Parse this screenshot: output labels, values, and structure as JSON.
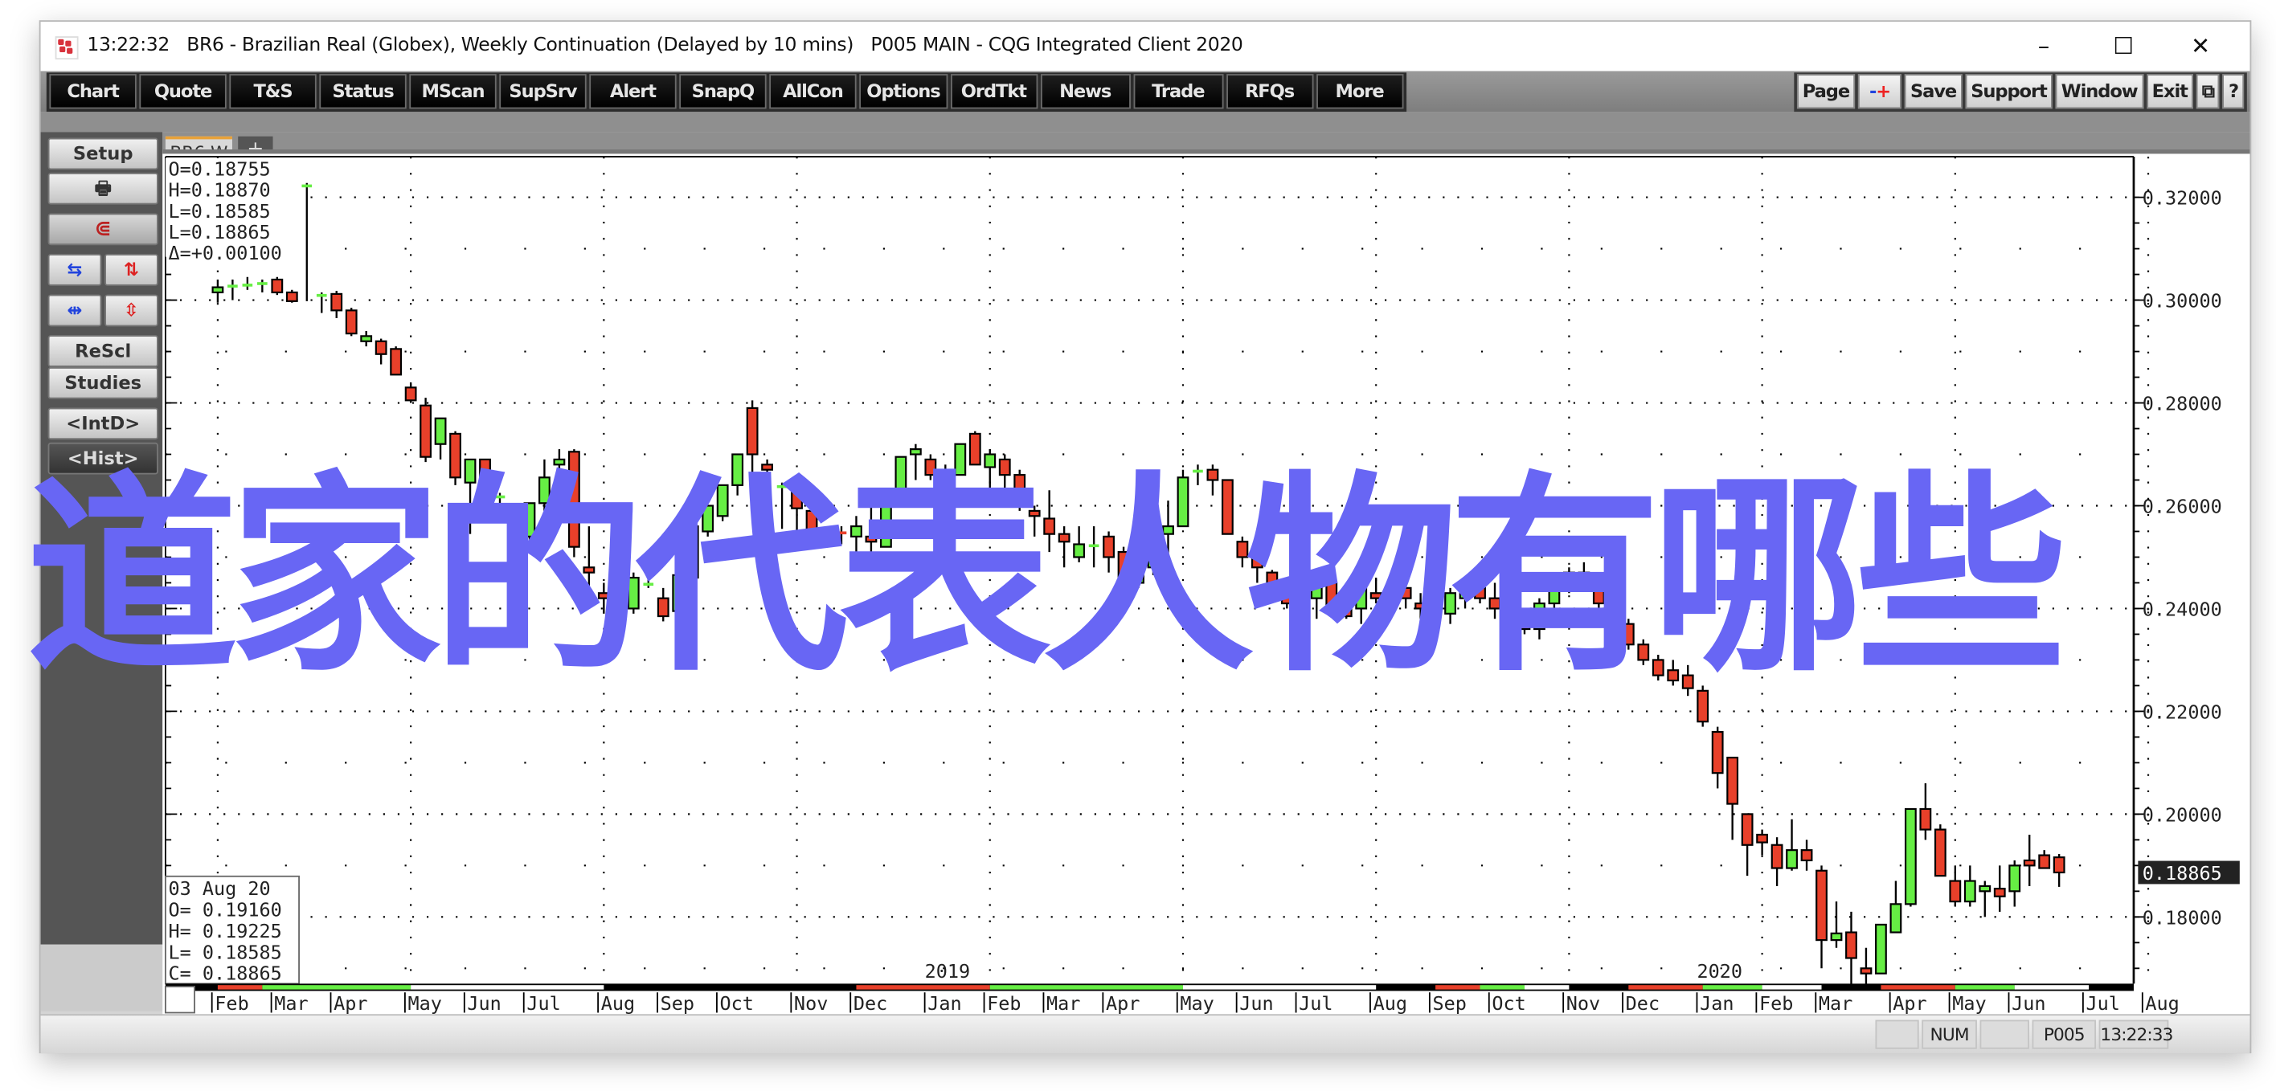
{
  "window": {
    "title": "13:22:32   BR6 - Brazilian Real (Globex), Weekly Continuation (Delayed by 10 mins)   P005 MAIN - CQG Integrated Client 2020",
    "controls": [
      "–",
      "☐",
      "✕"
    ]
  },
  "menubar": {
    "left": [
      "Chart",
      "Quote",
      "T&S",
      "Status",
      "MScan",
      "SupSrv",
      "Alert",
      "SnapQ",
      "AllCon",
      "Options",
      "OrdTkt",
      "News",
      "Trade",
      "RFQs",
      "More"
    ],
    "right": [
      "Page",
      "-+",
      "Save",
      "Support",
      "Window",
      "Exit",
      "⧉",
      "?"
    ]
  },
  "sidebar": {
    "setup": "Setup",
    "print_icon": "printer-icon",
    "magnet_icon": "magnet-icon",
    "rescale": "ReScl",
    "studies": "Studies",
    "intd": "<IntD>",
    "hist": "<Hist>"
  },
  "tabs": {
    "active": "BR6,W",
    "add": "+"
  },
  "cursor_box": {
    "lines": [
      "O=0.18755",
      "H=0.18870",
      "L=0.18585",
      "L=0.18865",
      "Δ=+0.00100"
    ]
  },
  "bar_info": {
    "lines": [
      "03 Aug 20",
      "O= 0.19160",
      "H= 0.19225",
      "L= 0.18585",
      "C= 0.18865"
    ]
  },
  "last_price": "0.18865",
  "overlay_text": "道家的代表人物有哪些",
  "statusbar": {
    "cells": [
      "",
      "NUM",
      "",
      "P005",
      "13:22:33"
    ]
  },
  "colors": {
    "up": "#66ee44",
    "down": "#e8402a",
    "overlay": "#6866f4"
  },
  "chart_data": {
    "type": "candlestick",
    "title": "BR6 - Brazilian Real (Globex), Weekly Continuation",
    "ylabel": "",
    "ylim": [
      0.165,
      0.323
    ],
    "yticks": [
      "0.32000",
      "0.30000",
      "0.28000",
      "0.26000",
      "0.24000",
      "0.22000",
      "0.20000",
      "0.18000"
    ],
    "ytick_values": [
      0.32,
      0.3,
      0.28,
      0.26,
      0.24,
      0.22,
      0.2,
      0.18
    ],
    "xticks": [
      "Feb",
      "Mar",
      "Apr",
      "May",
      "Jun",
      "Jul",
      "Aug",
      "Sep",
      "Oct",
      "Nov",
      "Dec",
      "Jan",
      "Feb",
      "Mar",
      "Apr",
      "May",
      "Jun",
      "Jul",
      "Aug",
      "Sep",
      "Oct",
      "Nov",
      "Dec",
      "Jan",
      "Feb",
      "Mar",
      "Apr",
      "May",
      "Jun",
      "Jul",
      "Aug"
    ],
    "xtick_weeks": [
      1,
      5,
      9,
      14,
      18,
      22,
      27,
      31,
      35,
      40,
      44,
      49,
      53,
      57,
      61,
      66,
      70,
      74,
      79,
      83,
      87,
      92,
      96,
      101,
      105,
      109,
      114,
      118,
      122,
      127,
      131
    ],
    "year_labels": [
      {
        "label": "2019",
        "week": 49
      },
      {
        "label": "2020",
        "week": 101
      }
    ],
    "grid": true,
    "candles": [
      [
        0.3015,
        0.304,
        0.2995,
        0.3025
      ],
      [
        0.3025,
        0.304,
        0.3,
        0.303
      ],
      [
        0.303,
        0.3045,
        0.302,
        0.3032
      ],
      [
        0.3032,
        0.304,
        0.3015,
        0.3035
      ],
      [
        0.304,
        0.3045,
        0.301,
        0.3015
      ],
      [
        0.3015,
        0.302,
        0.2995,
        0.2998
      ],
      [
        0.3225,
        0.3228,
        0.2998,
        0.3225
      ],
      [
        0.301,
        0.3015,
        0.2975,
        0.3012
      ],
      [
        0.3012,
        0.3018,
        0.2965,
        0.298
      ],
      [
        0.298,
        0.2985,
        0.293,
        0.2935
      ],
      [
        0.292,
        0.294,
        0.291,
        0.293
      ],
      [
        0.292,
        0.2925,
        0.2875,
        0.2895
      ],
      [
        0.2905,
        0.291,
        0.2855,
        0.2855
      ],
      [
        0.283,
        0.284,
        0.28,
        0.2805
      ],
      [
        0.2795,
        0.281,
        0.2685,
        0.2695
      ],
      [
        0.272,
        0.277,
        0.269,
        0.277
      ],
      [
        0.274,
        0.2745,
        0.264,
        0.2655
      ],
      [
        0.2645,
        0.269,
        0.2545,
        0.269
      ],
      [
        0.269,
        0.269,
        0.259,
        0.2615
      ],
      [
        0.262,
        0.2625,
        0.26,
        0.262
      ],
      [
        0.259,
        0.26,
        0.254,
        0.255
      ],
      [
        0.254,
        0.2605,
        0.253,
        0.2605
      ],
      [
        0.2605,
        0.269,
        0.259,
        0.2655
      ],
      [
        0.268,
        0.271,
        0.265,
        0.269
      ],
      [
        0.2705,
        0.271,
        0.25,
        0.252
      ],
      [
        0.248,
        0.256,
        0.24,
        0.247
      ],
      [
        0.243,
        0.245,
        0.239,
        0.242
      ],
      [
        0.238,
        0.242,
        0.237,
        0.239
      ],
      [
        0.24,
        0.247,
        0.239,
        0.246
      ],
      [
        0.245,
        0.2475,
        0.244,
        0.245
      ],
      [
        0.242,
        0.244,
        0.2375,
        0.2385
      ],
      [
        0.2395,
        0.247,
        0.238,
        0.2465
      ],
      [
        0.246,
        0.256,
        0.242,
        0.256
      ],
      [
        0.255,
        0.259,
        0.254,
        0.26
      ],
      [
        0.258,
        0.264,
        0.257,
        0.264
      ],
      [
        0.264,
        0.268,
        0.262,
        0.27
      ],
      [
        0.279,
        0.2805,
        0.2605,
        0.27
      ],
      [
        0.268,
        0.269,
        0.263,
        0.267
      ],
      [
        0.264,
        0.2645,
        0.2555,
        0.264
      ],
      [
        0.263,
        0.264,
        0.255,
        0.2595
      ],
      [
        0.259,
        0.262,
        0.254,
        0.255
      ],
      [
        0.254,
        0.255,
        0.252,
        0.253
      ],
      [
        0.255,
        0.256,
        0.2525,
        0.2545
      ],
      [
        0.254,
        0.258,
        0.249,
        0.256
      ],
      [
        0.254,
        0.26,
        0.248,
        0.253
      ],
      [
        0.252,
        0.261,
        0.252,
        0.26
      ],
      [
        0.2605,
        0.265,
        0.26,
        0.2695
      ],
      [
        0.27,
        0.272,
        0.265,
        0.271
      ],
      [
        0.269,
        0.27,
        0.265,
        0.266
      ],
      [
        0.266,
        0.268,
        0.261,
        0.2662
      ],
      [
        0.266,
        0.272,
        0.267,
        0.272
      ],
      [
        0.274,
        0.2745,
        0.268,
        0.268
      ],
      [
        0.2675,
        0.271,
        0.2605,
        0.27
      ],
      [
        0.269,
        0.27,
        0.263,
        0.266
      ],
      [
        0.266,
        0.267,
        0.259,
        0.26
      ],
      [
        0.259,
        0.26,
        0.254,
        0.258
      ],
      [
        0.2575,
        0.263,
        0.251,
        0.2545
      ],
      [
        0.2545,
        0.256,
        0.248,
        0.253
      ],
      [
        0.25,
        0.256,
        0.249,
        0.2525
      ],
      [
        0.252,
        0.256,
        0.248,
        0.2525
      ],
      [
        0.254,
        0.255,
        0.247,
        0.25
      ],
      [
        0.251,
        0.252,
        0.242,
        0.243
      ],
      [
        0.245,
        0.25,
        0.244,
        0.249
      ],
      [
        0.248,
        0.2545,
        0.2465,
        0.2545
      ],
      [
        0.2545,
        0.261,
        0.25,
        0.256
      ],
      [
        0.256,
        0.267,
        0.256,
        0.2655
      ],
      [
        0.2665,
        0.268,
        0.264,
        0.267
      ],
      [
        0.267,
        0.268,
        0.262,
        0.265
      ],
      [
        0.265,
        0.263,
        0.2545,
        0.2545
      ],
      [
        0.253,
        0.254,
        0.248,
        0.25
      ],
      [
        0.25,
        0.251,
        0.245,
        0.248
      ],
      [
        0.247,
        0.2475,
        0.242,
        0.2425
      ],
      [
        0.243,
        0.244,
        0.24,
        0.241
      ],
      [
        0.241,
        0.243,
        0.24,
        0.2415
      ],
      [
        0.242,
        0.246,
        0.238,
        0.246
      ],
      [
        0.245,
        0.248,
        0.241,
        0.24
      ],
      [
        0.24,
        0.2415,
        0.238,
        0.2385
      ],
      [
        0.24,
        0.244,
        0.237,
        0.244
      ],
      [
        0.243,
        0.246,
        0.241,
        0.242
      ],
      [
        0.242,
        0.245,
        0.238,
        0.244
      ],
      [
        0.244,
        0.245,
        0.24,
        0.242
      ],
      [
        0.241,
        0.243,
        0.238,
        0.24
      ],
      [
        0.24,
        0.242,
        0.236,
        0.239
      ],
      [
        0.239,
        0.244,
        0.237,
        0.243
      ],
      [
        0.242,
        0.245,
        0.24,
        0.2445
      ],
      [
        0.244,
        0.246,
        0.241,
        0.242
      ],
      [
        0.242,
        0.245,
        0.238,
        0.24
      ],
      [
        0.24,
        0.242,
        0.236,
        0.238
      ],
      [
        0.238,
        0.24,
        0.235,
        0.236
      ],
      [
        0.236,
        0.242,
        0.234,
        0.241
      ],
      [
        0.241,
        0.245,
        0.239,
        0.244
      ],
      [
        0.244,
        0.248,
        0.243,
        0.247
      ],
      [
        0.247,
        0.249,
        0.244,
        0.245
      ],
      [
        0.245,
        0.246,
        0.24,
        0.241
      ],
      [
        0.241,
        0.242,
        0.236,
        0.237
      ],
      [
        0.237,
        0.238,
        0.232,
        0.233
      ],
      [
        0.233,
        0.234,
        0.229,
        0.23
      ],
      [
        0.23,
        0.231,
        0.226,
        0.227
      ],
      [
        0.228,
        0.23,
        0.225,
        0.226
      ],
      [
        0.227,
        0.229,
        0.223,
        0.2245
      ],
      [
        0.224,
        0.225,
        0.217,
        0.218
      ],
      [
        0.216,
        0.217,
        0.205,
        0.208
      ],
      [
        0.211,
        0.21,
        0.195,
        0.202
      ],
      [
        0.2,
        0.2,
        0.188,
        0.194
      ],
      [
        0.196,
        0.197,
        0.192,
        0.1945
      ],
      [
        0.194,
        0.1955,
        0.186,
        0.1895
      ],
      [
        0.1895,
        0.199,
        0.189,
        0.193
      ],
      [
        0.193,
        0.195,
        0.189,
        0.191
      ],
      [
        0.189,
        0.19,
        0.17,
        0.1755
      ],
      [
        0.1755,
        0.183,
        0.174,
        0.1768
      ],
      [
        0.177,
        0.181,
        0.167,
        0.172
      ],
      [
        0.17,
        0.174,
        0.166,
        0.169
      ],
      [
        0.169,
        0.178,
        0.169,
        0.1785
      ],
      [
        0.177,
        0.187,
        0.177,
        0.1825
      ],
      [
        0.1825,
        0.192,
        0.182,
        0.201
      ],
      [
        0.201,
        0.206,
        0.195,
        0.197
      ],
      [
        0.197,
        0.198,
        0.19,
        0.188
      ],
      [
        0.187,
        0.19,
        0.182,
        0.183
      ],
      [
        0.183,
        0.19,
        0.182,
        0.187
      ],
      [
        0.185,
        0.187,
        0.18,
        0.186
      ],
      [
        0.1855,
        0.19,
        0.181,
        0.184
      ],
      [
        0.185,
        0.191,
        0.182,
        0.19
      ],
      [
        0.191,
        0.196,
        0.186,
        0.19
      ],
      [
        0.192,
        0.193,
        0.19,
        0.1895
      ],
      [
        0.1916,
        0.19225,
        0.18585,
        0.18865
      ]
    ]
  }
}
